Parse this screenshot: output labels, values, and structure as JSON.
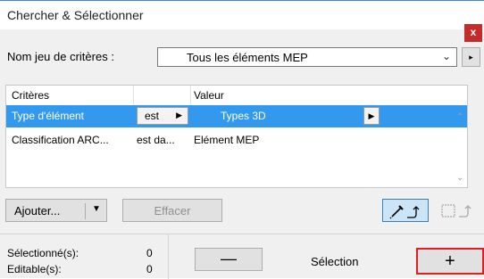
{
  "window": {
    "title": "Chercher & Sélectionner",
    "close_glyph": "x"
  },
  "criteria_set": {
    "label": "Nom jeu de critères :",
    "selected": "Tous les éléments MEP",
    "next_glyph": "▸"
  },
  "table": {
    "headers": [
      "Critères",
      "",
      "Valeur"
    ],
    "rows": [
      {
        "criterion": "Type d'élément",
        "operator": "est",
        "value": "Types 3D",
        "selected": true
      },
      {
        "criterion": "Classification ARC...",
        "operator": "est da...",
        "value": "Elément MEP",
        "selected": false
      }
    ]
  },
  "buttons": {
    "add": "Ajouter...",
    "clear": "Effacer",
    "minus": "—",
    "plus": "+"
  },
  "tools": {
    "pick_icon": "eyedropper-icon",
    "marquee_icon": "marquee-icon"
  },
  "status": {
    "selected_label": "Sélectionné(s):",
    "selected_count": "0",
    "editable_label": "Editable(s):",
    "editable_count": "0",
    "selection_label": "Sélection"
  },
  "colors": {
    "accent": "#3399ee",
    "close": "#c42b2b",
    "highlight_border": "#e02020"
  }
}
